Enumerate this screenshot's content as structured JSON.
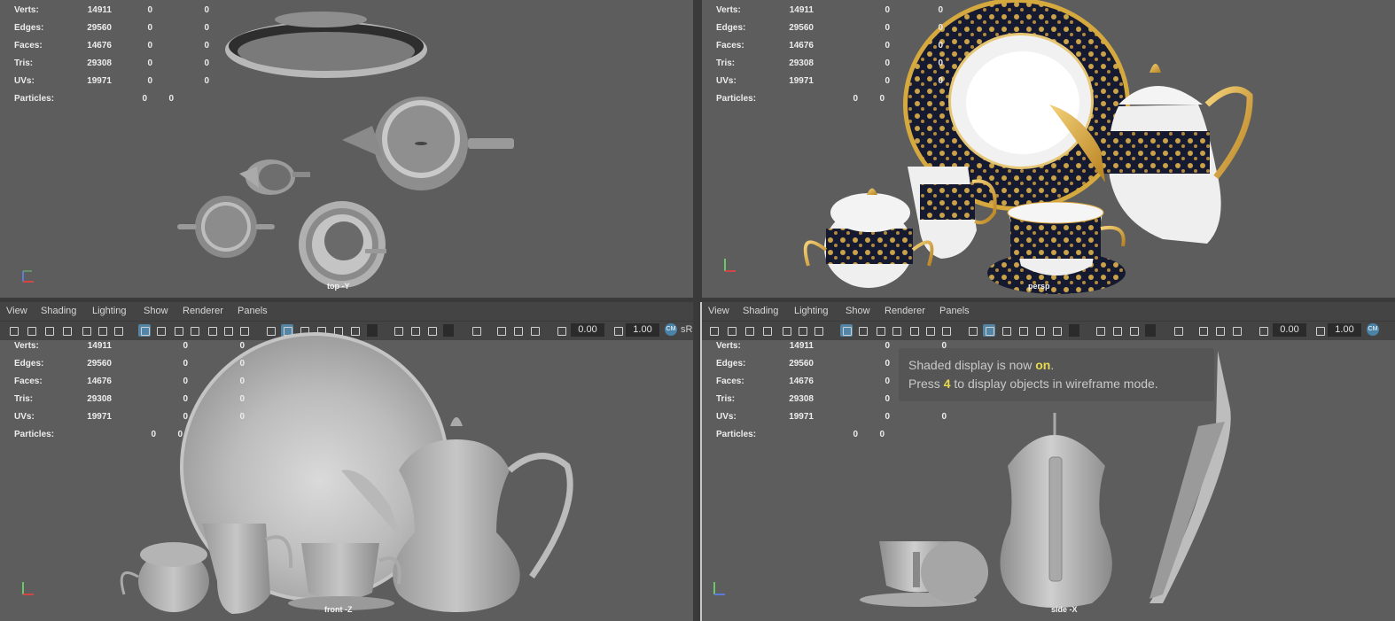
{
  "hud_labels": {
    "verts": "Verts:",
    "edges": "Edges:",
    "faces": "Faces:",
    "tris": "Tris:",
    "uvs": "UVs:",
    "particles": "Particles:"
  },
  "hud_values": {
    "verts": [
      "14911",
      "0",
      "0"
    ],
    "edges": [
      "29560",
      "0",
      "0"
    ],
    "faces": [
      "14676",
      "0",
      "0"
    ],
    "tris": [
      "29308",
      "0",
      "0"
    ],
    "uvs": [
      "19971",
      "0",
      "0"
    ],
    "particles": [
      "0",
      "0"
    ]
  },
  "menu": {
    "view": "View",
    "shading": "Shading",
    "lighting": "Lighting",
    "show": "Show",
    "renderer": "Renderer",
    "panels": "Panels"
  },
  "toolbar": {
    "exposure": "0.00",
    "gamma": "1.00",
    "colorspace": "sR",
    "cm_badge": "CM"
  },
  "viewports": {
    "top": {
      "camera": "top -Y"
    },
    "persp": {
      "camera": "persp"
    },
    "front": {
      "camera": "front -Z"
    },
    "side": {
      "camera": "side -X"
    }
  },
  "message": {
    "line1_prefix": "Shaded display is now ",
    "line1_highlight": "on",
    "line1_suffix": ".",
    "line2_prefix": "Press ",
    "line2_highlight": "4",
    "line2_suffix": " to display objects in wireframe mode."
  },
  "colors": {
    "viewport_bg": "#5d5d5d",
    "panel_bar": "#444444",
    "active_button": "#5285a6",
    "highlight_text": "#e6d94a",
    "gold": "#d9a53a",
    "navy": "#141a33",
    "porcelain": "#e8e8e8"
  },
  "icons": [
    "camera-icon",
    "grid-icon",
    "shaded-cube-icon",
    "light-icon",
    "isolate-icon",
    "color-management-icon"
  ]
}
